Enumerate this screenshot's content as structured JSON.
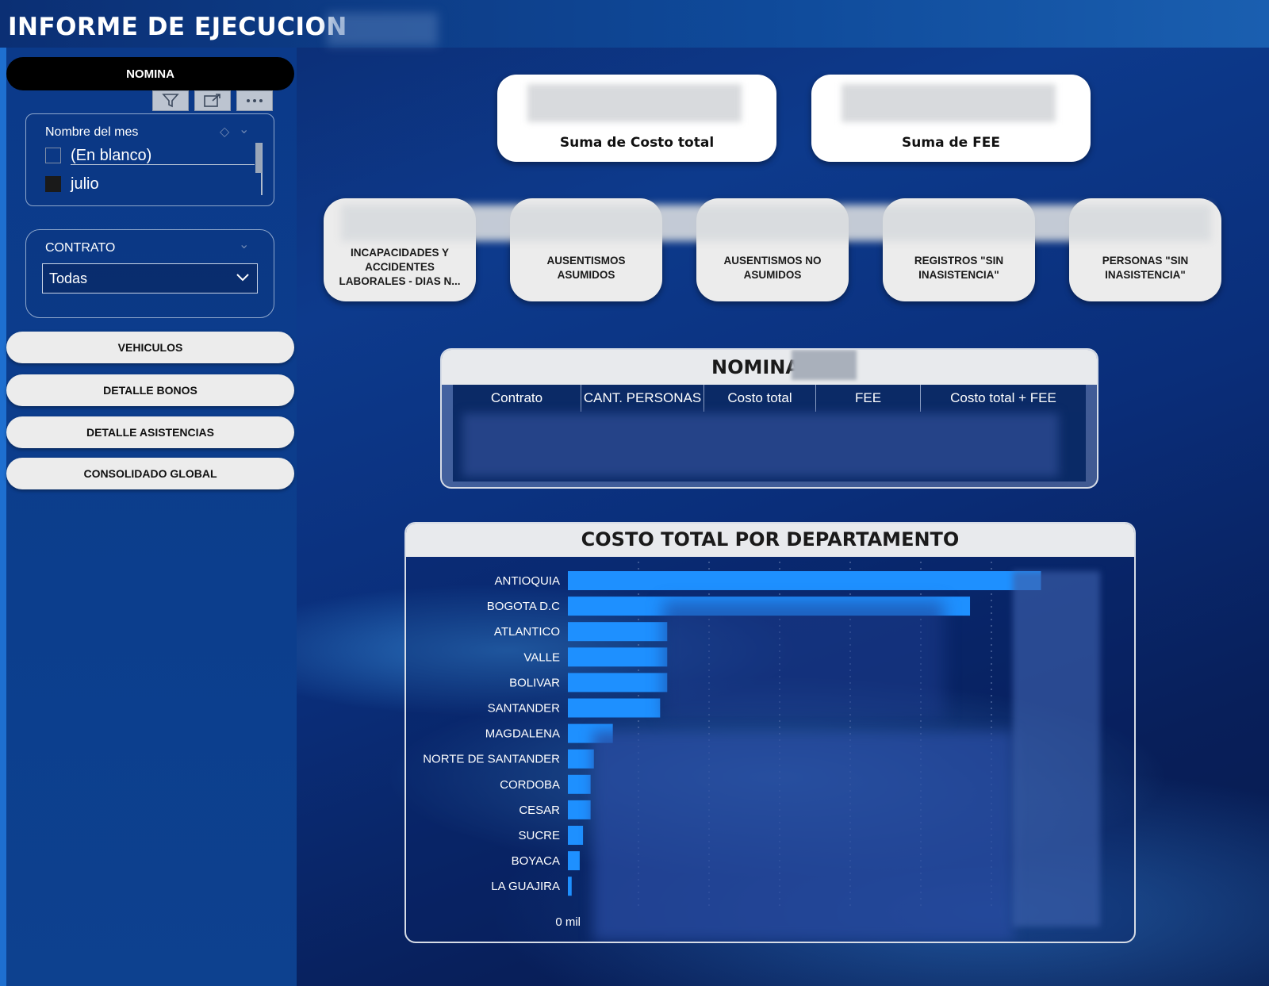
{
  "header": {
    "title": "INFORME DE EJECUCION"
  },
  "sidebar": {
    "active_item": "NOMINA",
    "toolbar_icons": [
      "filter-icon",
      "focus-mode-icon",
      "more-options-icon"
    ],
    "month_slicer": {
      "title": "Nombre del mes",
      "options": [
        {
          "label": "(En blanco)",
          "checked": false
        },
        {
          "label": "julio",
          "checked": true
        }
      ]
    },
    "contract_slicer": {
      "title": "CONTRATO",
      "selected": "Todas"
    },
    "nav_items": [
      "VEHICULOS",
      "DETALLE BONOS",
      "DETALLE ASISTENCIAS",
      "CONSOLIDADO GLOBAL"
    ]
  },
  "kpis": [
    {
      "label": "Suma de Costo total"
    },
    {
      "label": "Suma de FEE"
    }
  ],
  "indicator_cards": [
    {
      "label": "INCAPACIDADES Y ACCIDENTES LABORALES - DIAS N..."
    },
    {
      "label": "AUSENTISMOS ASUMIDOS"
    },
    {
      "label": "AUSENTISMOS NO ASUMIDOS"
    },
    {
      "label": "REGISTROS \"SIN INASISTENCIA\""
    },
    {
      "label": "PERSONAS \"SIN INASISTENCIA\""
    }
  ],
  "table": {
    "title": "NOMINA",
    "columns": [
      "Contrato",
      "CANT. PERSONAS",
      "Costo total",
      "FEE",
      "Costo total + FEE"
    ]
  },
  "chart_data": {
    "type": "bar",
    "orientation": "horizontal",
    "title": "COSTO TOTAL POR DEPARTAMENTO",
    "categories": [
      "ANTIOQUIA",
      "BOGOTA D.C",
      "ATLANTICO",
      "VALLE",
      "BOLIVAR",
      "SANTANDER",
      "MAGDALENA",
      "NORTE DE SANTANDER",
      "CORDOBA",
      "CESAR",
      "SUCRE",
      "BOYACA",
      "LA GUAJIRA"
    ],
    "values": [
      100,
      85,
      21,
      21,
      21,
      19.5,
      9.5,
      5.5,
      4.8,
      4.8,
      3.2,
      2.5,
      0.8
    ],
    "x_tick_labels": [
      "0 mil"
    ],
    "bar_color": "#1e90ff",
    "xlim": [
      0,
      115
    ]
  },
  "colors": {
    "background": "#0d3a8c",
    "sidebar": "#0b3a8a",
    "bar": "#1e90ff",
    "card": "#ececec"
  }
}
